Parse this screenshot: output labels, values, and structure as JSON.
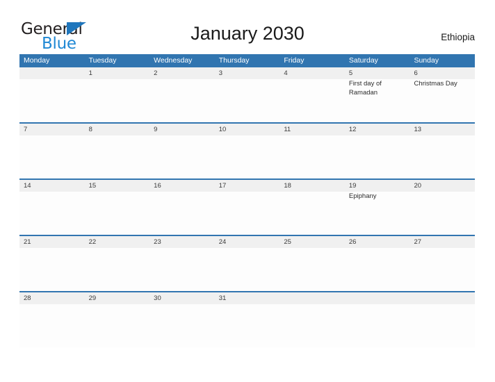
{
  "brand": {
    "name_part1": "General",
    "name_part2": "Blue",
    "triangle_icon": "triangle-icon",
    "color_dark": "#231f20",
    "color_blue": "#1f88d4"
  },
  "header": {
    "title": "January 2030",
    "country": "Ethiopia"
  },
  "colors": {
    "header_blue": "#3175b0",
    "row_strip_gray": "#f0f0f0",
    "cell_white": "#fdfdfd",
    "text_dark": "#1a1a1a"
  },
  "calendar": {
    "weekdays": [
      "Monday",
      "Tuesday",
      "Wednesday",
      "Thursday",
      "Friday",
      "Saturday",
      "Sunday"
    ],
    "weeks": [
      {
        "days": [
          {
            "number": "",
            "events": []
          },
          {
            "number": "1",
            "events": []
          },
          {
            "number": "2",
            "events": []
          },
          {
            "number": "3",
            "events": []
          },
          {
            "number": "4",
            "events": []
          },
          {
            "number": "5",
            "events": [
              "First day of Ramadan"
            ]
          },
          {
            "number": "6",
            "events": [
              "Christmas Day"
            ]
          }
        ]
      },
      {
        "days": [
          {
            "number": "7",
            "events": []
          },
          {
            "number": "8",
            "events": []
          },
          {
            "number": "9",
            "events": []
          },
          {
            "number": "10",
            "events": []
          },
          {
            "number": "11",
            "events": []
          },
          {
            "number": "12",
            "events": []
          },
          {
            "number": "13",
            "events": []
          }
        ]
      },
      {
        "days": [
          {
            "number": "14",
            "events": []
          },
          {
            "number": "15",
            "events": []
          },
          {
            "number": "16",
            "events": []
          },
          {
            "number": "17",
            "events": []
          },
          {
            "number": "18",
            "events": []
          },
          {
            "number": "19",
            "events": [
              "Epiphany"
            ]
          },
          {
            "number": "20",
            "events": []
          }
        ]
      },
      {
        "days": [
          {
            "number": "21",
            "events": []
          },
          {
            "number": "22",
            "events": []
          },
          {
            "number": "23",
            "events": []
          },
          {
            "number": "24",
            "events": []
          },
          {
            "number": "25",
            "events": []
          },
          {
            "number": "26",
            "events": []
          },
          {
            "number": "27",
            "events": []
          }
        ]
      },
      {
        "days": [
          {
            "number": "28",
            "events": []
          },
          {
            "number": "29",
            "events": []
          },
          {
            "number": "30",
            "events": []
          },
          {
            "number": "31",
            "events": []
          },
          {
            "number": "",
            "events": []
          },
          {
            "number": "",
            "events": []
          },
          {
            "number": "",
            "events": []
          }
        ]
      }
    ]
  }
}
